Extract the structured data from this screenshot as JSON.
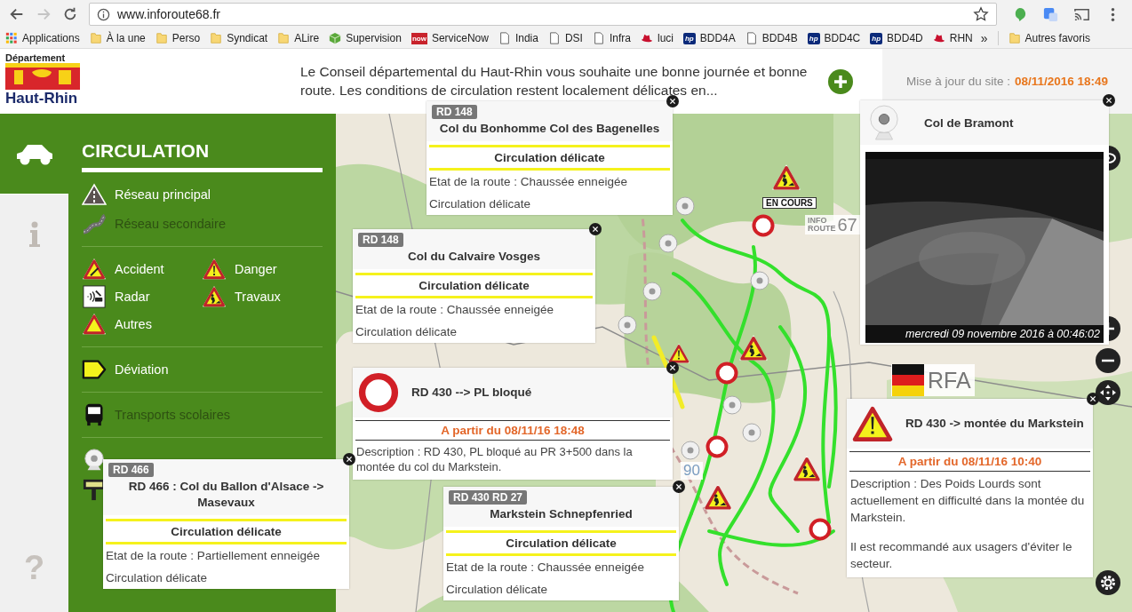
{
  "browser": {
    "nav": [
      {
        "kind": "back",
        "disabled": false
      },
      {
        "kind": "forward",
        "disabled": true
      },
      {
        "kind": "reload",
        "disabled": false
      }
    ],
    "url": "www.inforoute68.fr"
  },
  "bookmarks": [
    {
      "label": "Applications",
      "kind": "apps"
    },
    {
      "label": "À la une",
      "kind": "folder"
    },
    {
      "label": "Perso",
      "kind": "folder"
    },
    {
      "label": "Syndicat",
      "kind": "folder"
    },
    {
      "label": "ALire",
      "kind": "folder"
    },
    {
      "label": "Supervision",
      "kind": "cube"
    },
    {
      "label": "ServiceNow",
      "kind": "badge",
      "badge": "now"
    },
    {
      "label": "India",
      "kind": "page"
    },
    {
      "label": "DSI",
      "kind": "page"
    },
    {
      "label": "Infra",
      "kind": "page"
    },
    {
      "label": "luci",
      "kind": "hat"
    },
    {
      "label": "BDD4A",
      "kind": "hp",
      "badge": "hp"
    },
    {
      "label": "BDD4B",
      "kind": "page"
    },
    {
      "label": "BDD4C",
      "kind": "hp",
      "badge": "hp"
    },
    {
      "label": "BDD4D",
      "kind": "hp",
      "badge": "hp"
    },
    {
      "label": "RHN",
      "kind": "hat"
    }
  ],
  "bookmarks_more": "»",
  "other_bookmarks": "Autres favoris",
  "header": {
    "logo_top": "Département",
    "logo_bottom": "Haut-Rhin",
    "message": "Le Conseil départemental du Haut-Rhin vous souhaite une bonne journée et bonne route. Les conditions de circulation restent localement délicates en...",
    "update_label": "Mise à jour du site :",
    "update_time": "08/11/2016 18:49"
  },
  "sidebar": {
    "tabs": [
      {
        "kind": "car",
        "selected": true
      },
      {
        "kind": "info",
        "selected": false
      }
    ],
    "help": "?",
    "title": "CIRCULATION",
    "groups": [
      {
        "kind": "list",
        "items": [
          {
            "label": "Réseau principal",
            "kind": "road",
            "on": true
          },
          {
            "label": "Réseau secondaire",
            "kind": "winding",
            "on": false
          }
        ]
      },
      {
        "kind": "grid",
        "items": [
          {
            "label": "Accident",
            "kind": "accident",
            "on": true
          },
          {
            "label": "Danger",
            "kind": "danger",
            "on": true
          },
          {
            "label": "Radar",
            "kind": "radar",
            "on": true
          },
          {
            "label": "Travaux",
            "kind": "works",
            "on": true
          },
          {
            "label": "Autres",
            "kind": "other",
            "on": true
          }
        ]
      },
      {
        "kind": "list",
        "items": [
          {
            "label": "Déviation",
            "kind": "detour",
            "on": true
          }
        ]
      },
      {
        "kind": "list",
        "items": [
          {
            "label": "Transports scolaires",
            "kind": "bus",
            "on": false
          }
        ]
      },
      {
        "kind": "list",
        "items": [
          {
            "kind": "webcam"
          },
          {
            "kind": "panel"
          }
        ]
      }
    ]
  },
  "map": {
    "work_badge": "EN COURS",
    "logo": [
      "INFO",
      "ROUTE",
      "67"
    ],
    "logo_small": "90",
    "country": "RFA"
  },
  "popups": [
    {
      "kind": "road",
      "badge": "RD 148",
      "title": "Col du Bonhomme Col des Bagenelles",
      "status": "Circulation délicate",
      "lines": [
        "Etat de la route : Chaussée enneigée",
        "Circulation délicate"
      ]
    },
    {
      "kind": "road",
      "badge": "RD 148",
      "title": "Col du Calvaire Vosges",
      "status": "Circulation délicate",
      "lines": [
        "Etat de la route : Chaussée enneigée",
        "Circulation délicate"
      ]
    },
    {
      "kind": "closure",
      "title": "RD 430 --> PL bloqué",
      "date": "A partir du 08/11/16 18:48",
      "description": [
        "Description : RD 430, PL bloqué au PR 3+500 dans la montée du col du Markstein."
      ]
    },
    {
      "kind": "camera",
      "title": "Col de Bramont",
      "caption": "mercredi 09 novembre 2016 à 00:46:02"
    },
    {
      "kind": "warning",
      "title": "RD 430 -> montée du Markstein",
      "date": "A partir du 08/11/16 10:40",
      "description": [
        "Description : Des Poids Lourds sont actuellement en difficulté dans la montée du Markstein.",
        "Il est recommandé aux usagers d'éviter le secteur."
      ]
    },
    {
      "kind": "road",
      "badge": "RD 466",
      "title": "RD 466 : Col du Ballon d'Alsace -> Masevaux",
      "status": "Circulation délicate",
      "lines": [
        "Etat de la route : Partiellement enneigée",
        "Circulation délicate"
      ]
    },
    {
      "kind": "road",
      "badge": "RD 430 RD 27",
      "title": "Markstein Schnepfenried",
      "status": "Circulation délicate",
      "lines": [
        "Etat de la route : Chaussée enneigée",
        "Circulation délicate"
      ]
    }
  ]
}
